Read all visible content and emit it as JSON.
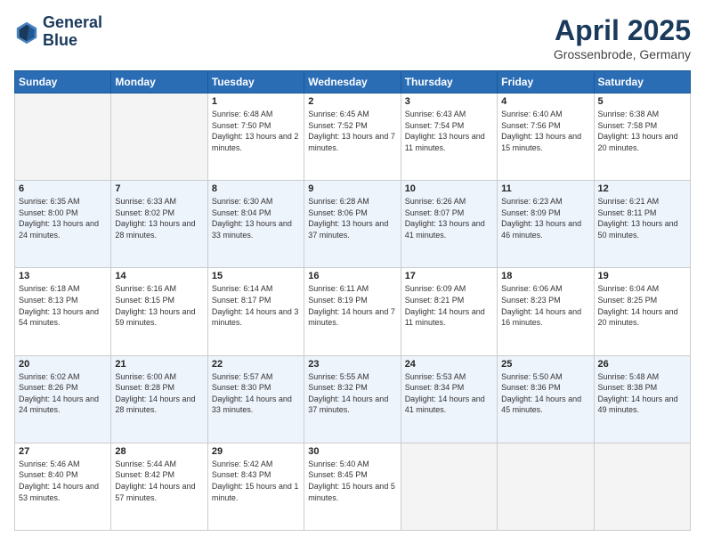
{
  "logo": {
    "line1": "General",
    "line2": "Blue"
  },
  "header": {
    "month": "April 2025",
    "location": "Grossenbrode, Germany"
  },
  "weekdays": [
    "Sunday",
    "Monday",
    "Tuesday",
    "Wednesday",
    "Thursday",
    "Friday",
    "Saturday"
  ],
  "weeks": [
    [
      {
        "day": "",
        "sunrise": "",
        "sunset": "",
        "daylight": ""
      },
      {
        "day": "",
        "sunrise": "",
        "sunset": "",
        "daylight": ""
      },
      {
        "day": "1",
        "sunrise": "Sunrise: 6:48 AM",
        "sunset": "Sunset: 7:50 PM",
        "daylight": "Daylight: 13 hours and 2 minutes."
      },
      {
        "day": "2",
        "sunrise": "Sunrise: 6:45 AM",
        "sunset": "Sunset: 7:52 PM",
        "daylight": "Daylight: 13 hours and 7 minutes."
      },
      {
        "day": "3",
        "sunrise": "Sunrise: 6:43 AM",
        "sunset": "Sunset: 7:54 PM",
        "daylight": "Daylight: 13 hours and 11 minutes."
      },
      {
        "day": "4",
        "sunrise": "Sunrise: 6:40 AM",
        "sunset": "Sunset: 7:56 PM",
        "daylight": "Daylight: 13 hours and 15 minutes."
      },
      {
        "day": "5",
        "sunrise": "Sunrise: 6:38 AM",
        "sunset": "Sunset: 7:58 PM",
        "daylight": "Daylight: 13 hours and 20 minutes."
      }
    ],
    [
      {
        "day": "6",
        "sunrise": "Sunrise: 6:35 AM",
        "sunset": "Sunset: 8:00 PM",
        "daylight": "Daylight: 13 hours and 24 minutes."
      },
      {
        "day": "7",
        "sunrise": "Sunrise: 6:33 AM",
        "sunset": "Sunset: 8:02 PM",
        "daylight": "Daylight: 13 hours and 28 minutes."
      },
      {
        "day": "8",
        "sunrise": "Sunrise: 6:30 AM",
        "sunset": "Sunset: 8:04 PM",
        "daylight": "Daylight: 13 hours and 33 minutes."
      },
      {
        "day": "9",
        "sunrise": "Sunrise: 6:28 AM",
        "sunset": "Sunset: 8:06 PM",
        "daylight": "Daylight: 13 hours and 37 minutes."
      },
      {
        "day": "10",
        "sunrise": "Sunrise: 6:26 AM",
        "sunset": "Sunset: 8:07 PM",
        "daylight": "Daylight: 13 hours and 41 minutes."
      },
      {
        "day": "11",
        "sunrise": "Sunrise: 6:23 AM",
        "sunset": "Sunset: 8:09 PM",
        "daylight": "Daylight: 13 hours and 46 minutes."
      },
      {
        "day": "12",
        "sunrise": "Sunrise: 6:21 AM",
        "sunset": "Sunset: 8:11 PM",
        "daylight": "Daylight: 13 hours and 50 minutes."
      }
    ],
    [
      {
        "day": "13",
        "sunrise": "Sunrise: 6:18 AM",
        "sunset": "Sunset: 8:13 PM",
        "daylight": "Daylight: 13 hours and 54 minutes."
      },
      {
        "day": "14",
        "sunrise": "Sunrise: 6:16 AM",
        "sunset": "Sunset: 8:15 PM",
        "daylight": "Daylight: 13 hours and 59 minutes."
      },
      {
        "day": "15",
        "sunrise": "Sunrise: 6:14 AM",
        "sunset": "Sunset: 8:17 PM",
        "daylight": "Daylight: 14 hours and 3 minutes."
      },
      {
        "day": "16",
        "sunrise": "Sunrise: 6:11 AM",
        "sunset": "Sunset: 8:19 PM",
        "daylight": "Daylight: 14 hours and 7 minutes."
      },
      {
        "day": "17",
        "sunrise": "Sunrise: 6:09 AM",
        "sunset": "Sunset: 8:21 PM",
        "daylight": "Daylight: 14 hours and 11 minutes."
      },
      {
        "day": "18",
        "sunrise": "Sunrise: 6:06 AM",
        "sunset": "Sunset: 8:23 PM",
        "daylight": "Daylight: 14 hours and 16 minutes."
      },
      {
        "day": "19",
        "sunrise": "Sunrise: 6:04 AM",
        "sunset": "Sunset: 8:25 PM",
        "daylight": "Daylight: 14 hours and 20 minutes."
      }
    ],
    [
      {
        "day": "20",
        "sunrise": "Sunrise: 6:02 AM",
        "sunset": "Sunset: 8:26 PM",
        "daylight": "Daylight: 14 hours and 24 minutes."
      },
      {
        "day": "21",
        "sunrise": "Sunrise: 6:00 AM",
        "sunset": "Sunset: 8:28 PM",
        "daylight": "Daylight: 14 hours and 28 minutes."
      },
      {
        "day": "22",
        "sunrise": "Sunrise: 5:57 AM",
        "sunset": "Sunset: 8:30 PM",
        "daylight": "Daylight: 14 hours and 33 minutes."
      },
      {
        "day": "23",
        "sunrise": "Sunrise: 5:55 AM",
        "sunset": "Sunset: 8:32 PM",
        "daylight": "Daylight: 14 hours and 37 minutes."
      },
      {
        "day": "24",
        "sunrise": "Sunrise: 5:53 AM",
        "sunset": "Sunset: 8:34 PM",
        "daylight": "Daylight: 14 hours and 41 minutes."
      },
      {
        "day": "25",
        "sunrise": "Sunrise: 5:50 AM",
        "sunset": "Sunset: 8:36 PM",
        "daylight": "Daylight: 14 hours and 45 minutes."
      },
      {
        "day": "26",
        "sunrise": "Sunrise: 5:48 AM",
        "sunset": "Sunset: 8:38 PM",
        "daylight": "Daylight: 14 hours and 49 minutes."
      }
    ],
    [
      {
        "day": "27",
        "sunrise": "Sunrise: 5:46 AM",
        "sunset": "Sunset: 8:40 PM",
        "daylight": "Daylight: 14 hours and 53 minutes."
      },
      {
        "day": "28",
        "sunrise": "Sunrise: 5:44 AM",
        "sunset": "Sunset: 8:42 PM",
        "daylight": "Daylight: 14 hours and 57 minutes."
      },
      {
        "day": "29",
        "sunrise": "Sunrise: 5:42 AM",
        "sunset": "Sunset: 8:43 PM",
        "daylight": "Daylight: 15 hours and 1 minute."
      },
      {
        "day": "30",
        "sunrise": "Sunrise: 5:40 AM",
        "sunset": "Sunset: 8:45 PM",
        "daylight": "Daylight: 15 hours and 5 minutes."
      },
      {
        "day": "",
        "sunrise": "",
        "sunset": "",
        "daylight": ""
      },
      {
        "day": "",
        "sunrise": "",
        "sunset": "",
        "daylight": ""
      },
      {
        "day": "",
        "sunrise": "",
        "sunset": "",
        "daylight": ""
      }
    ]
  ]
}
